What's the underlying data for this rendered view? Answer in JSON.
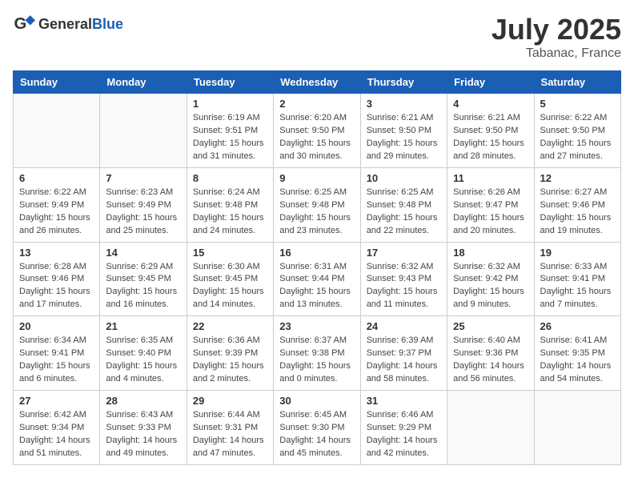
{
  "header": {
    "logo_general": "General",
    "logo_blue": "Blue",
    "title": "July 2025",
    "location": "Tabanac, France"
  },
  "weekdays": [
    "Sunday",
    "Monday",
    "Tuesday",
    "Wednesday",
    "Thursday",
    "Friday",
    "Saturday"
  ],
  "weeks": [
    [
      {
        "day": "",
        "info": ""
      },
      {
        "day": "",
        "info": ""
      },
      {
        "day": "1",
        "info": "Sunrise: 6:19 AM\nSunset: 9:51 PM\nDaylight: 15 hours\nand 31 minutes."
      },
      {
        "day": "2",
        "info": "Sunrise: 6:20 AM\nSunset: 9:50 PM\nDaylight: 15 hours\nand 30 minutes."
      },
      {
        "day": "3",
        "info": "Sunrise: 6:21 AM\nSunset: 9:50 PM\nDaylight: 15 hours\nand 29 minutes."
      },
      {
        "day": "4",
        "info": "Sunrise: 6:21 AM\nSunset: 9:50 PM\nDaylight: 15 hours\nand 28 minutes."
      },
      {
        "day": "5",
        "info": "Sunrise: 6:22 AM\nSunset: 9:50 PM\nDaylight: 15 hours\nand 27 minutes."
      }
    ],
    [
      {
        "day": "6",
        "info": "Sunrise: 6:22 AM\nSunset: 9:49 PM\nDaylight: 15 hours\nand 26 minutes."
      },
      {
        "day": "7",
        "info": "Sunrise: 6:23 AM\nSunset: 9:49 PM\nDaylight: 15 hours\nand 25 minutes."
      },
      {
        "day": "8",
        "info": "Sunrise: 6:24 AM\nSunset: 9:48 PM\nDaylight: 15 hours\nand 24 minutes."
      },
      {
        "day": "9",
        "info": "Sunrise: 6:25 AM\nSunset: 9:48 PM\nDaylight: 15 hours\nand 23 minutes."
      },
      {
        "day": "10",
        "info": "Sunrise: 6:25 AM\nSunset: 9:48 PM\nDaylight: 15 hours\nand 22 minutes."
      },
      {
        "day": "11",
        "info": "Sunrise: 6:26 AM\nSunset: 9:47 PM\nDaylight: 15 hours\nand 20 minutes."
      },
      {
        "day": "12",
        "info": "Sunrise: 6:27 AM\nSunset: 9:46 PM\nDaylight: 15 hours\nand 19 minutes."
      }
    ],
    [
      {
        "day": "13",
        "info": "Sunrise: 6:28 AM\nSunset: 9:46 PM\nDaylight: 15 hours\nand 17 minutes."
      },
      {
        "day": "14",
        "info": "Sunrise: 6:29 AM\nSunset: 9:45 PM\nDaylight: 15 hours\nand 16 minutes."
      },
      {
        "day": "15",
        "info": "Sunrise: 6:30 AM\nSunset: 9:45 PM\nDaylight: 15 hours\nand 14 minutes."
      },
      {
        "day": "16",
        "info": "Sunrise: 6:31 AM\nSunset: 9:44 PM\nDaylight: 15 hours\nand 13 minutes."
      },
      {
        "day": "17",
        "info": "Sunrise: 6:32 AM\nSunset: 9:43 PM\nDaylight: 15 hours\nand 11 minutes."
      },
      {
        "day": "18",
        "info": "Sunrise: 6:32 AM\nSunset: 9:42 PM\nDaylight: 15 hours\nand 9 minutes."
      },
      {
        "day": "19",
        "info": "Sunrise: 6:33 AM\nSunset: 9:41 PM\nDaylight: 15 hours\nand 7 minutes."
      }
    ],
    [
      {
        "day": "20",
        "info": "Sunrise: 6:34 AM\nSunset: 9:41 PM\nDaylight: 15 hours\nand 6 minutes."
      },
      {
        "day": "21",
        "info": "Sunrise: 6:35 AM\nSunset: 9:40 PM\nDaylight: 15 hours\nand 4 minutes."
      },
      {
        "day": "22",
        "info": "Sunrise: 6:36 AM\nSunset: 9:39 PM\nDaylight: 15 hours\nand 2 minutes."
      },
      {
        "day": "23",
        "info": "Sunrise: 6:37 AM\nSunset: 9:38 PM\nDaylight: 15 hours\nand 0 minutes."
      },
      {
        "day": "24",
        "info": "Sunrise: 6:39 AM\nSunset: 9:37 PM\nDaylight: 14 hours\nand 58 minutes."
      },
      {
        "day": "25",
        "info": "Sunrise: 6:40 AM\nSunset: 9:36 PM\nDaylight: 14 hours\nand 56 minutes."
      },
      {
        "day": "26",
        "info": "Sunrise: 6:41 AM\nSunset: 9:35 PM\nDaylight: 14 hours\nand 54 minutes."
      }
    ],
    [
      {
        "day": "27",
        "info": "Sunrise: 6:42 AM\nSunset: 9:34 PM\nDaylight: 14 hours\nand 51 minutes."
      },
      {
        "day": "28",
        "info": "Sunrise: 6:43 AM\nSunset: 9:33 PM\nDaylight: 14 hours\nand 49 minutes."
      },
      {
        "day": "29",
        "info": "Sunrise: 6:44 AM\nSunset: 9:31 PM\nDaylight: 14 hours\nand 47 minutes."
      },
      {
        "day": "30",
        "info": "Sunrise: 6:45 AM\nSunset: 9:30 PM\nDaylight: 14 hours\nand 45 minutes."
      },
      {
        "day": "31",
        "info": "Sunrise: 6:46 AM\nSunset: 9:29 PM\nDaylight: 14 hours\nand 42 minutes."
      },
      {
        "day": "",
        "info": ""
      },
      {
        "day": "",
        "info": ""
      }
    ]
  ]
}
